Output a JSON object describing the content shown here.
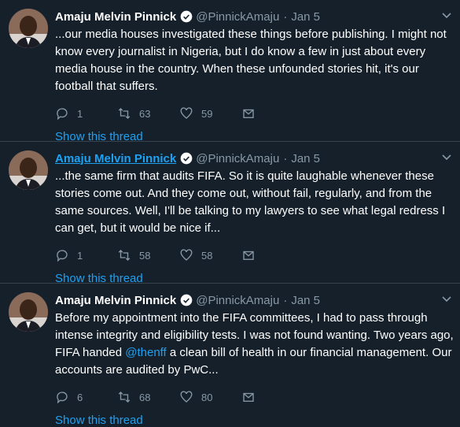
{
  "tweets": [
    {
      "name": "Amaju Melvin Pinnick",
      "handle": "@PinnickAmaju",
      "dot": "·",
      "date": "Jan 5",
      "text_before": "...our media houses investigated these things before publishing. I might not know every journalist in Nigeria, but I do know a few in just about every media house in the country. When these unfounded stories hit, it's our football that suffers.",
      "mention": "",
      "text_after": "",
      "replies": "1",
      "retweets": "63",
      "likes": "59",
      "show_thread": "Show this thread"
    },
    {
      "name": "Amaju Melvin Pinnick",
      "handle": "@PinnickAmaju",
      "dot": "·",
      "date": "Jan 5",
      "text_before": "...the same firm that audits FIFA. So it is quite laughable whenever these stories come out. And they come out, without fail, regularly, and from the same sources. Well, I'll be talking to my lawyers to see what legal redress I can get, but it would be nice if...",
      "mention": "",
      "text_after": "",
      "replies": "1",
      "retweets": "58",
      "likes": "58",
      "show_thread": "Show this thread"
    },
    {
      "name": "Amaju Melvin Pinnick",
      "handle": "@PinnickAmaju",
      "dot": "·",
      "date": "Jan 5",
      "text_before": "Before my appointment into the FIFA committees, I had to pass through intense integrity and eligibility tests. I was not found wanting. Two years ago, FIFA handed ",
      "mention": "@thenff",
      "text_after": " a clean bill of health in our financial management. Our accounts are audited by PwC...",
      "replies": "6",
      "retweets": "68",
      "likes": "80",
      "show_thread": "Show this thread"
    }
  ],
  "colors": {
    "background": "#15202b",
    "accent": "#1da1f2",
    "secondary_text": "#8899a6",
    "divider": "#38444d"
  },
  "icons": {
    "reply": "reply-icon",
    "retweet": "retweet-icon",
    "like": "heart-icon",
    "share": "envelope-icon",
    "verified": "verified-badge-icon",
    "caret": "chevron-down-icon"
  }
}
